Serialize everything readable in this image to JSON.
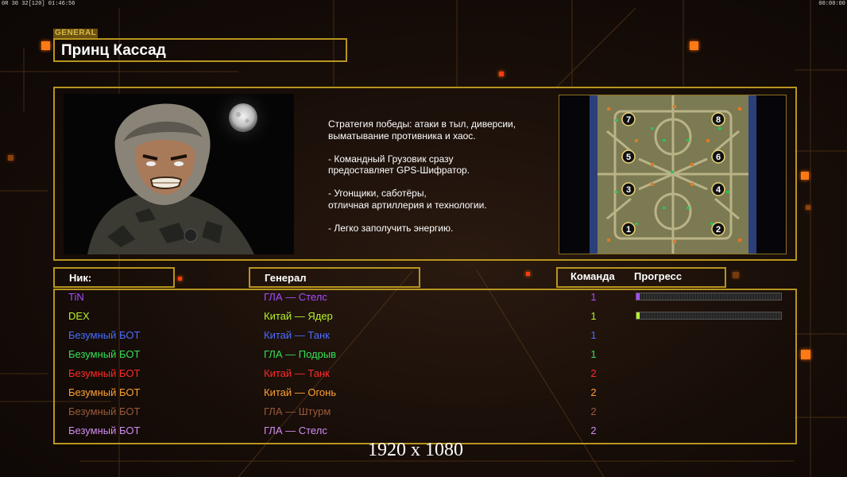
{
  "hud": {
    "top_left": "0R 30 32[120] 01:46:56",
    "top_right": "00:00:00"
  },
  "general": {
    "tag": "GENERAL",
    "name": "Принц Кассад"
  },
  "description": [
    "Стратегия победы: атаки в тыл, диверсии,\n выматывание противника и хаос.",
    "- Командный Грузовик сразу\nпредоставляет GPS-Шифратор.",
    "- Угонщики, саботёры,\nотличная артиллерия и технологии.",
    "- Легко заполучить энергию."
  ],
  "minimap": {
    "start_positions": [
      "7",
      "8",
      "5",
      "6",
      "3",
      "4",
      "1",
      "2"
    ]
  },
  "headers": {
    "nick": "Ник:",
    "general": "Генерал",
    "team": "Команда",
    "progress": "Прогресс"
  },
  "players": [
    {
      "nick": "TiN",
      "general": "ГЛА — Стелс",
      "team": "1",
      "color": "#a64dff",
      "progress": 0.015
    },
    {
      "nick": "DEX",
      "general": "Китай — Ядер",
      "team": "1",
      "color": "#b8f22e",
      "progress": 0.008
    },
    {
      "nick": "Безумный БОТ",
      "general": "Китай — Танк",
      "team": "1",
      "color": "#4a6cff",
      "progress": null
    },
    {
      "nick": "Безумный БОТ",
      "general": "ГЛА — Подрыв",
      "team": "1",
      "color": "#33e055",
      "progress": null
    },
    {
      "nick": "Безумный БОТ",
      "general": "Китай — Танк",
      "team": "2",
      "color": "#ff2a2a",
      "progress": null
    },
    {
      "nick": "Безумный БОТ",
      "general": "Китай — Огонь",
      "team": "2",
      "color": "#ffa033",
      "progress": null
    },
    {
      "nick": "Безумный БОТ",
      "general": "ГЛА — Штурм",
      "team": "2",
      "color": "#9a5a3a",
      "progress": null
    },
    {
      "nick": "Безумный БОТ",
      "general": "ГЛА — Стелс",
      "team": "2",
      "color": "#d08cf0",
      "progress": null
    }
  ],
  "overlay_text": "1920 x 1080",
  "colors": {
    "frame": "#b8951f",
    "accent": "#ff7a14"
  }
}
